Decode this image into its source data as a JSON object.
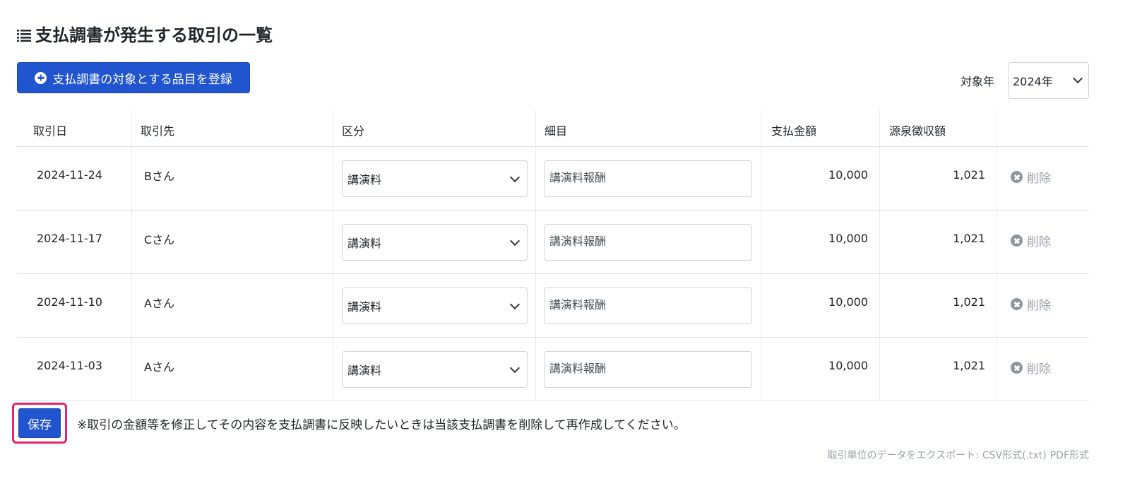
{
  "page": {
    "title": "支払調書が発生する取引の一覧",
    "register_button": "支払調書の対象とする品目を登録",
    "year_label": "対象年",
    "year_value": "2024年"
  },
  "table": {
    "headers": {
      "date": "取引日",
      "partner": "取引先",
      "kubun": "区分",
      "saimoku": "細目",
      "amount": "支払金額",
      "tax": "源泉徴収額"
    },
    "rows": [
      {
        "date": "2024-11-24",
        "partner": "Bさん",
        "kubun": "講演料",
        "saimoku": "講演料報酬",
        "amount": "10,000",
        "tax": "1,021",
        "delete": "削除"
      },
      {
        "date": "2024-11-17",
        "partner": "Cさん",
        "kubun": "講演料",
        "saimoku": "講演料報酬",
        "amount": "10,000",
        "tax": "1,021",
        "delete": "削除"
      },
      {
        "date": "2024-11-10",
        "partner": "Aさん",
        "kubun": "講演料",
        "saimoku": "講演料報酬",
        "amount": "10,000",
        "tax": "1,021",
        "delete": "削除"
      },
      {
        "date": "2024-11-03",
        "partner": "Aさん",
        "kubun": "講演料",
        "saimoku": "講演料報酬",
        "amount": "10,000",
        "tax": "1,021",
        "delete": "削除"
      }
    ]
  },
  "footer": {
    "save_label": "保存",
    "note": "※取引の金額等を修正してその内容を支払調書に反映したいときは当該支払調書を削除して再作成してください。",
    "export_label": "取引単位のデータをエクスポート:",
    "export_csv": "CSV形式(.txt)",
    "export_pdf": "PDF形式"
  },
  "colors": {
    "primary": "#2155cf",
    "highlight": "#e8256a",
    "muted": "#9aa0a6"
  },
  "icons": {
    "title": "list-icon",
    "register": "plus-circle-icon",
    "delete": "x-circle-icon",
    "dropdown": "chevron-down-icon"
  }
}
